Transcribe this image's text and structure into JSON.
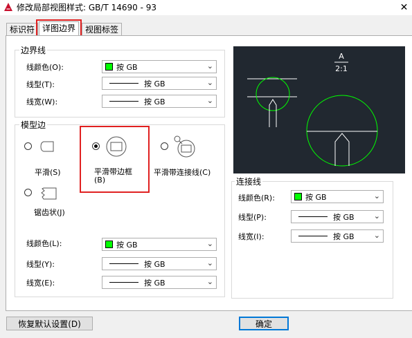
{
  "window": {
    "title": "修改局部视图样式: GB/T 14690 - 93",
    "close_glyph": "✕"
  },
  "tabs": [
    {
      "label": "标识符",
      "active": false
    },
    {
      "label": "详图边界",
      "active": true
    },
    {
      "label": "视图标签",
      "active": false
    }
  ],
  "boundary_line": {
    "group_label": "边界线",
    "color_label": "线颜色(O):",
    "color_value": "按 GB",
    "linetype_label": "线型(T):",
    "linetype_value": "按 GB",
    "lineweight_label": "线宽(W):",
    "lineweight_value": "按 GB"
  },
  "model_edge": {
    "group_label": "模型边",
    "options": [
      {
        "label": "平滑(S)",
        "checked": false
      },
      {
        "label": "平滑带边框",
        "label2": "(B)",
        "checked": true
      },
      {
        "label": "平滑带连接线(C)",
        "checked": false
      },
      {
        "label": "锯齿状(J)",
        "checked": false
      }
    ],
    "color_label": "线颜色(L):",
    "color_value": "按 GB",
    "linetype_label": "线型(Y):",
    "linetype_value": "按 GB",
    "lineweight_label": "线宽(E):",
    "lineweight_value": "按 GB"
  },
  "connection_line": {
    "group_label": "连接线",
    "color_label": "线颜色(R):",
    "color_value": "按 GB",
    "linetype_label": "线型(P):",
    "linetype_value": "按 GB",
    "lineweight_label": "线宽(I):",
    "lineweight_value": "按 GB"
  },
  "preview": {
    "label_letter": "A",
    "label_scale": "2:1"
  },
  "buttons": {
    "reset": "恢复默认设置(D)",
    "ok": "确定"
  },
  "colors": {
    "accent": "#0078d7",
    "highlight": "#e02020",
    "preview_bg": "#212830",
    "boundary_green": "#00ff00"
  }
}
